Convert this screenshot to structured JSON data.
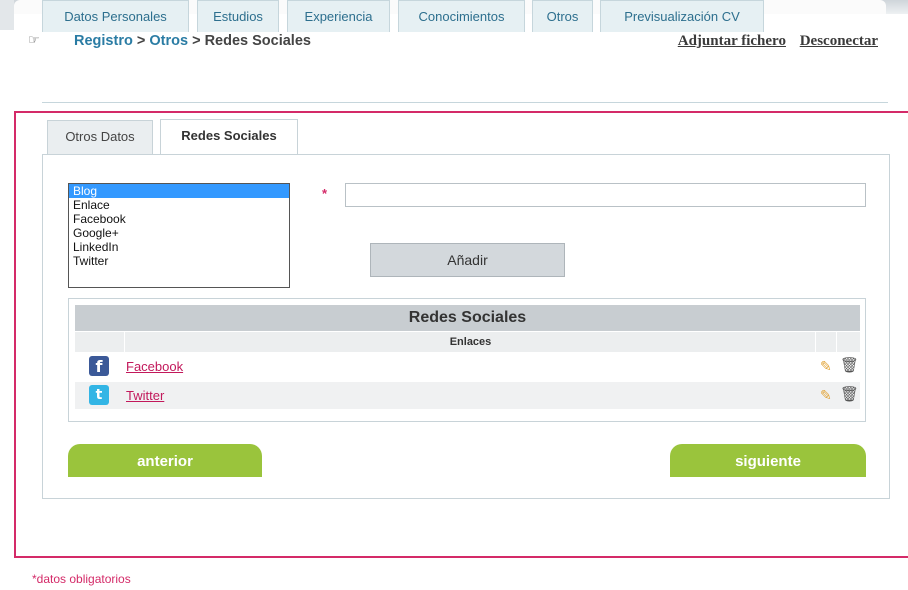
{
  "header": {
    "breadcrumb": {
      "root": "Registro",
      "sep1": ">",
      "middle": "Otros",
      "sep2": ">",
      "current": "Redes Sociales"
    },
    "links": {
      "attach": "Adjuntar fichero",
      "logout": "Desconectar"
    }
  },
  "main_tabs": [
    {
      "label": "Datos Personales"
    },
    {
      "label": "Estudios"
    },
    {
      "label": "Experiencia"
    },
    {
      "label": "Conocimientos"
    },
    {
      "label": "Otros"
    },
    {
      "label": "Previsualización CV"
    }
  ],
  "sub_tabs": [
    {
      "label": "Otros Datos",
      "active": false
    },
    {
      "label": "Redes Sociales",
      "active": true
    }
  ],
  "form": {
    "network_options": [
      "Blog",
      "Enlace",
      "Facebook",
      "Google+",
      "LinkedIn",
      "Twitter"
    ],
    "selected": "Blog",
    "required_mark": "*",
    "url_value": "",
    "add_label": "Añadir"
  },
  "table": {
    "title": "Redes Sociales",
    "column_links": "Enlaces",
    "rows": [
      {
        "icon": "facebook-icon",
        "glyph": "f",
        "label": "Facebook"
      },
      {
        "icon": "twitter-icon",
        "glyph": "t",
        "label": "Twitter"
      }
    ]
  },
  "nav": {
    "prev": "anterior",
    "next": "siguiente"
  },
  "footnote": "*datos obligatorios",
  "colors": {
    "accent_pink": "#d42a68",
    "tab_text": "#2d6f8e",
    "nav_green": "#9ac43c",
    "selected_option": "#3399ff"
  }
}
